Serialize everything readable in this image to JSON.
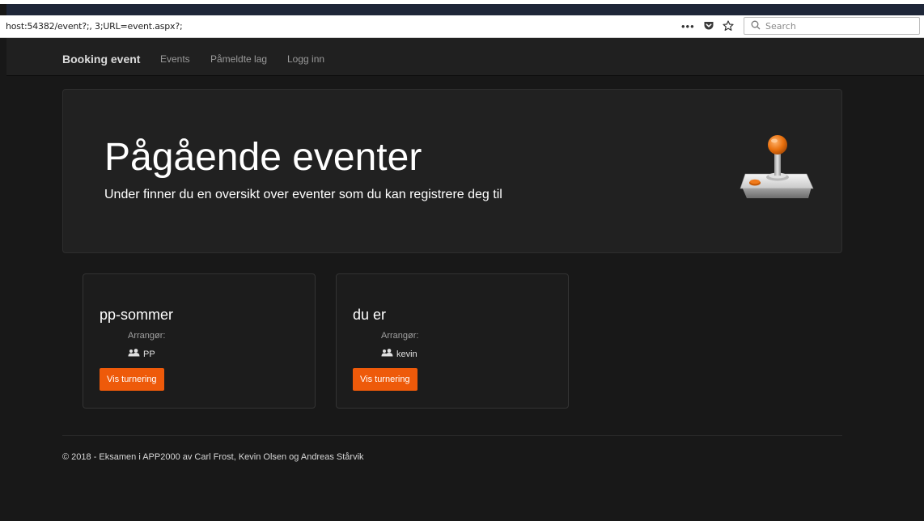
{
  "browser": {
    "url": "host:54382/event?;, 3;URL=event.aspx?;",
    "search_placeholder": "Search"
  },
  "navbar": {
    "brand": "Booking event",
    "links": [
      "Events",
      "Påmeldte lag",
      "Logg inn"
    ]
  },
  "jumbotron": {
    "title": "Pågående eventer",
    "subtitle": "Under finner du en oversikt over eventer som du kan registrere deg til"
  },
  "events": [
    {
      "name": "pp-sommer",
      "organizer_label": "Arrangør:",
      "organizer": "PP",
      "button": "Vis turnering"
    },
    {
      "name": "du er",
      "organizer_label": "Arrangør:",
      "organizer": "kevin",
      "button": "Vis turnering"
    }
  ],
  "footer": {
    "text": "© 2018 - Eksamen i APP2000 av Carl Frost, Kevin Olsen og Andreas Stårvik"
  },
  "colors": {
    "accent_button": "#ee5a0a",
    "page_background": "#181818",
    "navbar_background": "#202020"
  }
}
